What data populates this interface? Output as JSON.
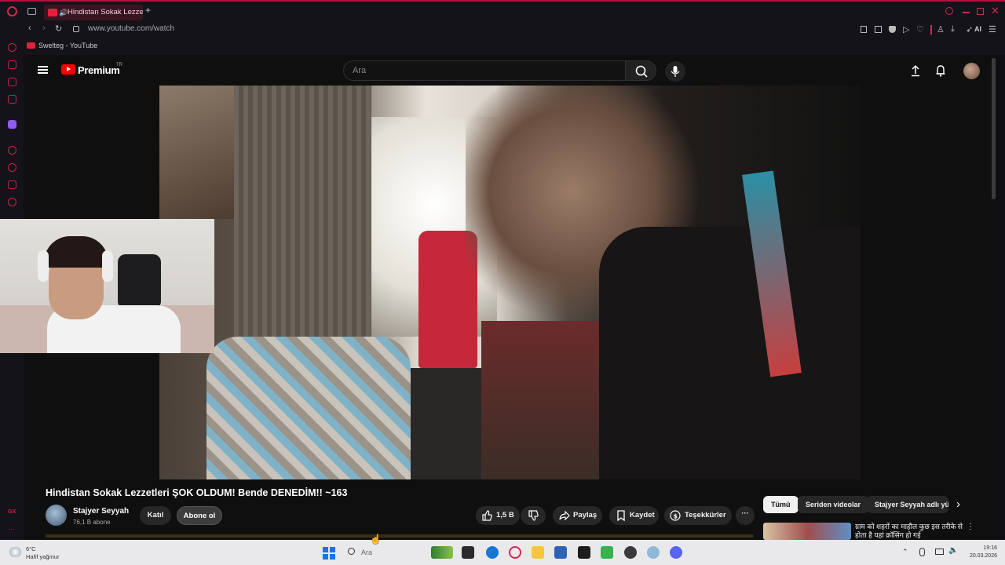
{
  "browser": {
    "tab_title": "Hindistan Sokak Lezzetleri",
    "new_tab": "+",
    "url": "www.youtube.com/watch",
    "bookmark_label": "Swelteg - YouTube",
    "toolbar_ai": "AI",
    "sidebar_gx": "GX"
  },
  "youtube": {
    "logo_text": "Premium",
    "logo_region": "TR",
    "search_placeholder": "Ara",
    "video_title": "Hindistan Sokak Lezzetleri ŞOK OLDUM! Bende DENEDİM!! ~163",
    "channel_name": "Stajyer Seyyah",
    "channel_subs": "76,1 B abone",
    "join_label": "Katıl",
    "subscribe_label": "Abone ol",
    "likes": "1,5 B",
    "share_label": "Paylaş",
    "save_label": "Kaydet",
    "thanks_label": "Teşekkürler",
    "more_label": "···",
    "chips": [
      "Tümü",
      "Seriden videolar",
      "Stajyer Seyyah adlı yü"
    ],
    "rec_title": "ग्राम को शहरों का माहौल कुछ इस तरीके से होता है यहां क्रॉसिंग हो गई"
  },
  "taskbar": {
    "temperature": "6°C",
    "weather": "Hafif yağmur",
    "search_placeholder": "Ara",
    "time": "19:16",
    "date": "20.03.2026"
  },
  "colors": {
    "accent": "#b3123c",
    "yt_red": "#ff0000",
    "yt_bg": "#0f0f0f"
  }
}
